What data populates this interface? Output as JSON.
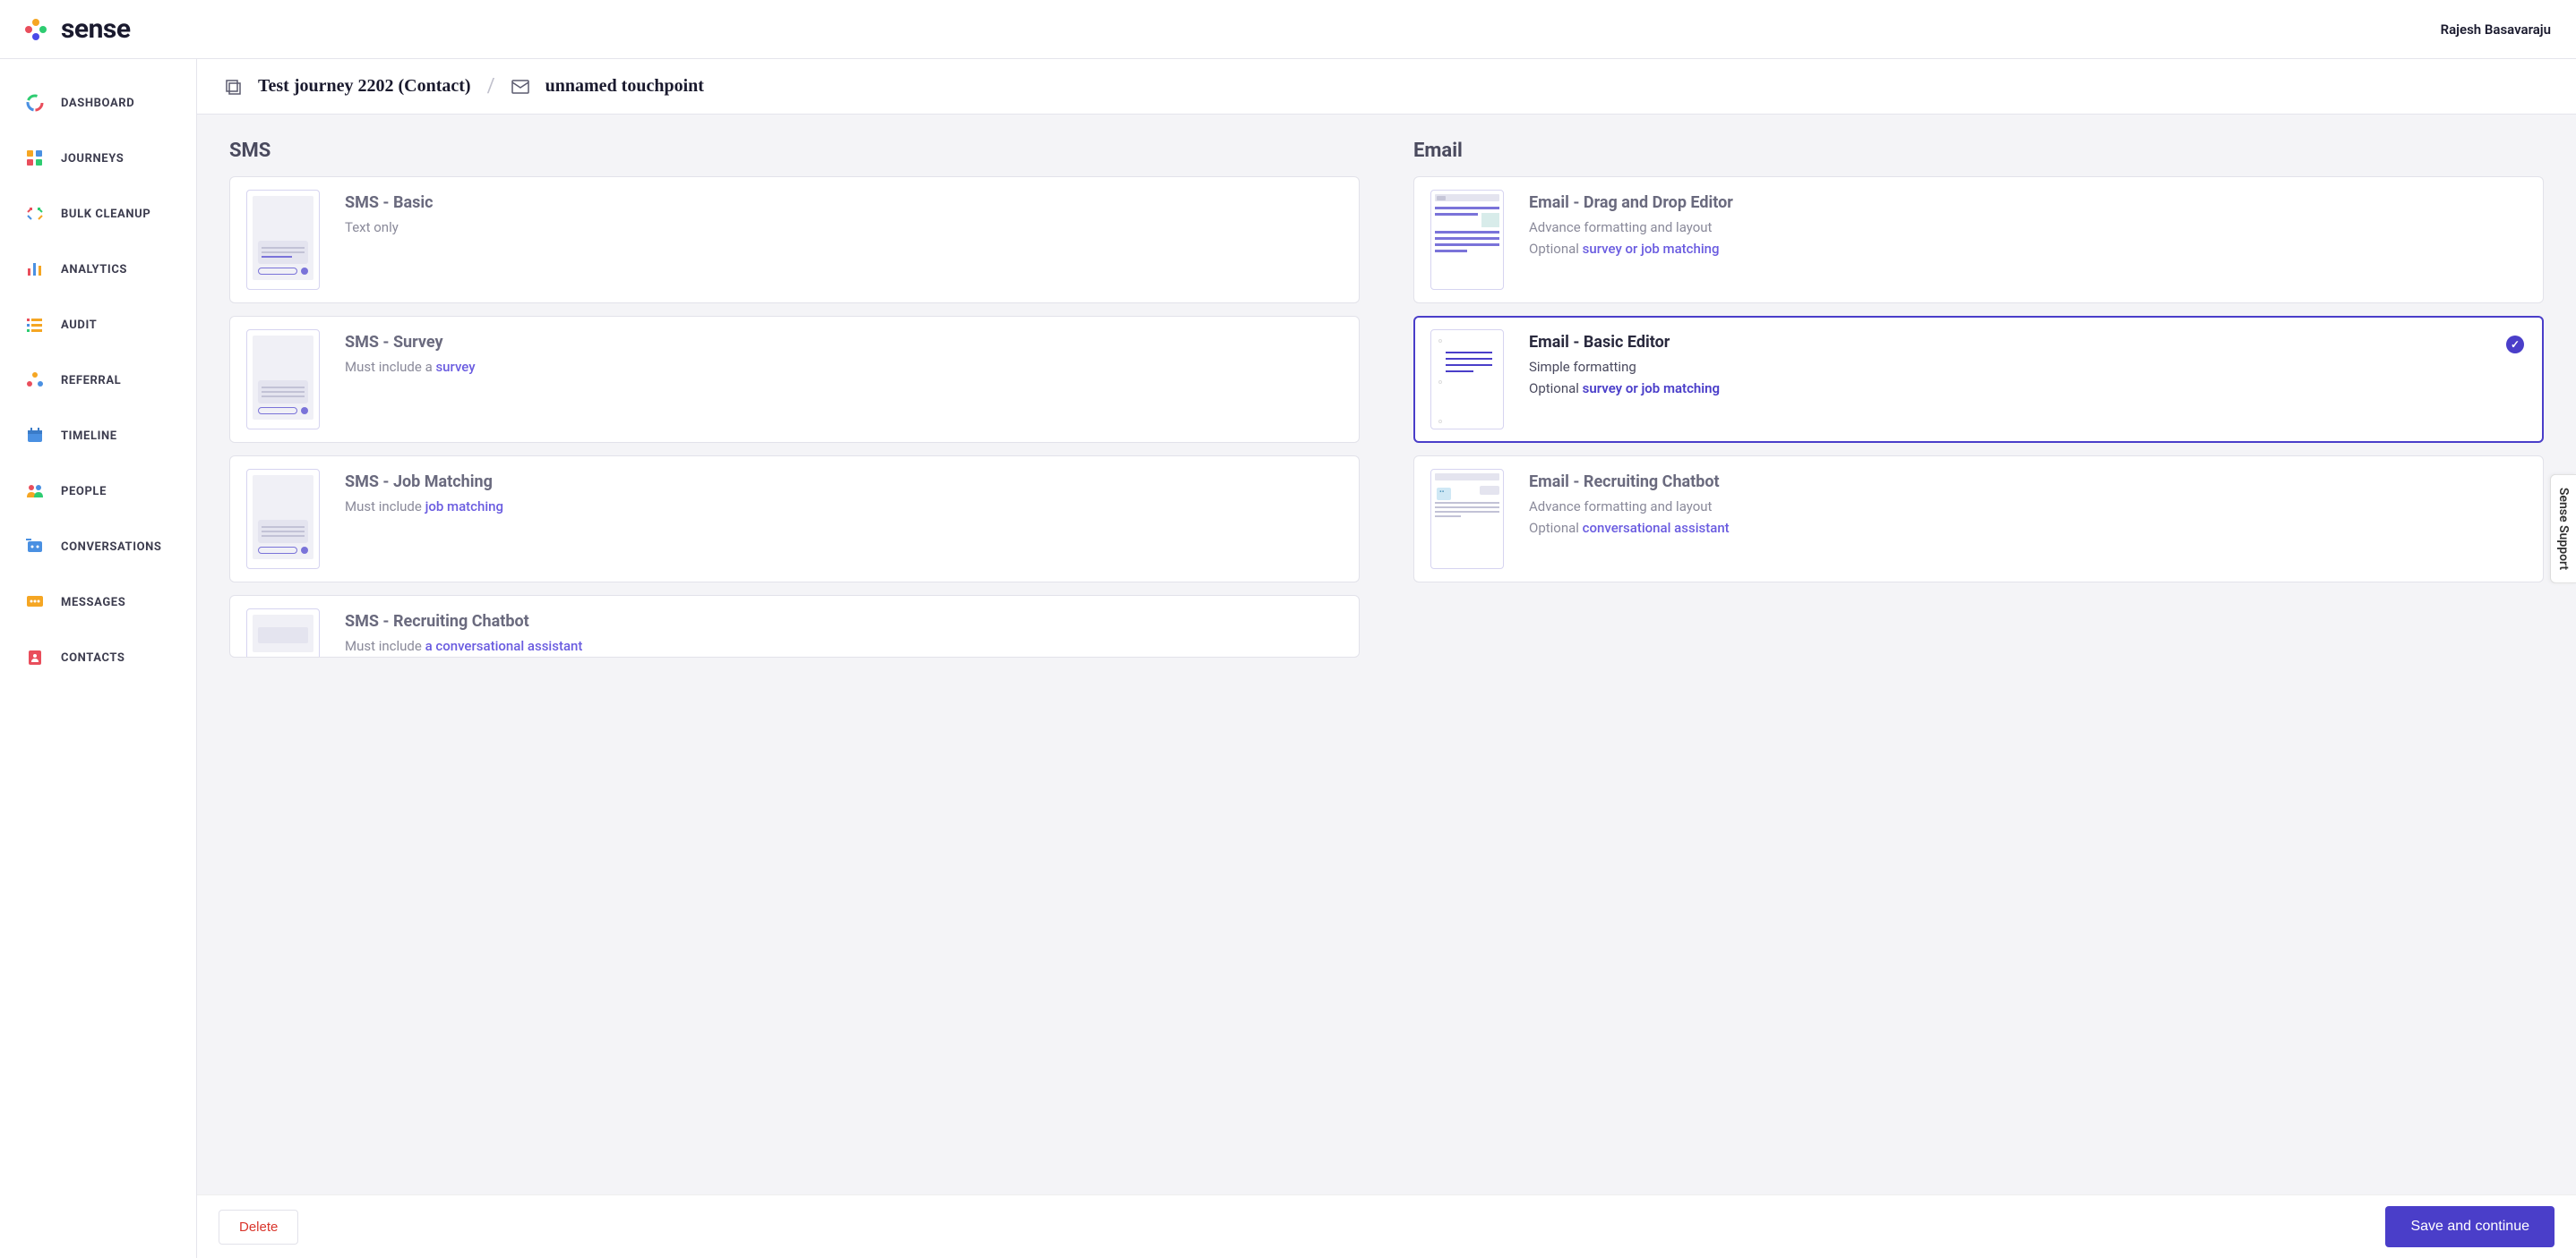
{
  "header": {
    "brand": "sense",
    "user": "Rajesh Basavaraju"
  },
  "sidebar": {
    "items": [
      {
        "label": "DASHBOARD",
        "icon": "dashboard"
      },
      {
        "label": "JOURNEYS",
        "icon": "journeys"
      },
      {
        "label": "BULK CLEANUP",
        "icon": "bulk"
      },
      {
        "label": "ANALYTICS",
        "icon": "analytics"
      },
      {
        "label": "AUDIT",
        "icon": "audit"
      },
      {
        "label": "REFERRAL",
        "icon": "referral"
      },
      {
        "label": "TIMELINE",
        "icon": "timeline"
      },
      {
        "label": "PEOPLE",
        "icon": "people"
      },
      {
        "label": "CONVERSATIONS",
        "icon": "conversations"
      },
      {
        "label": "MESSAGES",
        "icon": "messages"
      },
      {
        "label": "CONTACTS",
        "icon": "contacts"
      }
    ]
  },
  "breadcrumb": {
    "journey": "Test journey 2202 (Contact)",
    "touchpoint": "unnamed touchpoint"
  },
  "columns": {
    "sms": {
      "title": "SMS",
      "cards": [
        {
          "title": "SMS - Basic",
          "line1": "Text only",
          "line2": ""
        },
        {
          "title": "SMS - Survey",
          "line1_prefix": "Must include a ",
          "line1_link": "survey"
        },
        {
          "title": "SMS - Job Matching",
          "line1_prefix": "Must include ",
          "line1_link": "job matching"
        },
        {
          "title": "SMS - Recruiting Chatbot",
          "line1_prefix": "Must include ",
          "line1_link": "a conversational assistant"
        }
      ]
    },
    "email": {
      "title": "Email",
      "cards": [
        {
          "title": "Email - Drag and Drop Editor",
          "line1": "Advance formatting and layout",
          "line2_prefix": "Optional ",
          "line2_link": "survey or job matching",
          "selected": false
        },
        {
          "title": "Email - Basic Editor",
          "line1": "Simple formatting",
          "line2_prefix": "Optional ",
          "line2_link": "survey or job matching",
          "selected": true
        },
        {
          "title": "Email - Recruiting Chatbot",
          "line1": "Advance formatting and layout",
          "line2_prefix": "Optional ",
          "line2_link": "conversational assistant",
          "selected": false
        }
      ]
    }
  },
  "footer": {
    "delete": "Delete",
    "save": "Save and continue"
  },
  "support_tab": "Sense Support"
}
